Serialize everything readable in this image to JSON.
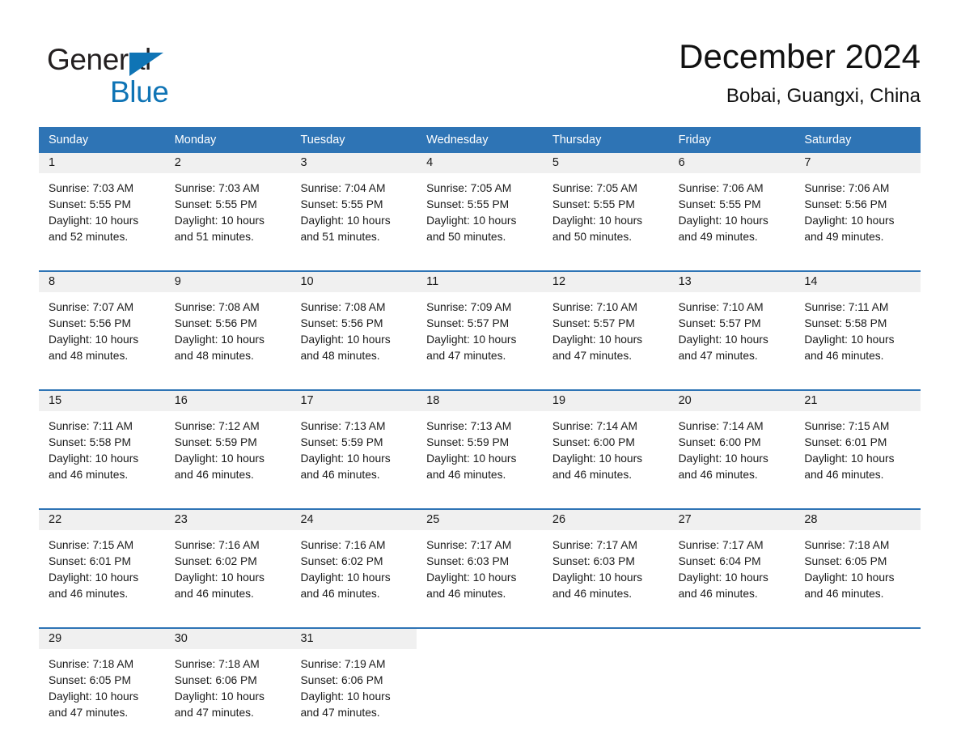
{
  "brand": {
    "name_part1": "General",
    "name_part2": "Blue",
    "triangle_color": "#0f74b5",
    "text_color": "#231f20"
  },
  "header": {
    "title": "December 2024",
    "subtitle": "Bobai, Guangxi, China"
  },
  "theme": {
    "header_blue": "#2e74b5",
    "daynum_bg": "#f0f0f0",
    "page_bg": "#ffffff"
  },
  "weekdays": [
    "Sunday",
    "Monday",
    "Tuesday",
    "Wednesday",
    "Thursday",
    "Friday",
    "Saturday"
  ],
  "weeks": [
    [
      {
        "day": "1",
        "sunrise": "Sunrise: 7:03 AM",
        "sunset": "Sunset: 5:55 PM",
        "daylight1": "Daylight: 10 hours",
        "daylight2": "and 52 minutes."
      },
      {
        "day": "2",
        "sunrise": "Sunrise: 7:03 AM",
        "sunset": "Sunset: 5:55 PM",
        "daylight1": "Daylight: 10 hours",
        "daylight2": "and 51 minutes."
      },
      {
        "day": "3",
        "sunrise": "Sunrise: 7:04 AM",
        "sunset": "Sunset: 5:55 PM",
        "daylight1": "Daylight: 10 hours",
        "daylight2": "and 51 minutes."
      },
      {
        "day": "4",
        "sunrise": "Sunrise: 7:05 AM",
        "sunset": "Sunset: 5:55 PM",
        "daylight1": "Daylight: 10 hours",
        "daylight2": "and 50 minutes."
      },
      {
        "day": "5",
        "sunrise": "Sunrise: 7:05 AM",
        "sunset": "Sunset: 5:55 PM",
        "daylight1": "Daylight: 10 hours",
        "daylight2": "and 50 minutes."
      },
      {
        "day": "6",
        "sunrise": "Sunrise: 7:06 AM",
        "sunset": "Sunset: 5:55 PM",
        "daylight1": "Daylight: 10 hours",
        "daylight2": "and 49 minutes."
      },
      {
        "day": "7",
        "sunrise": "Sunrise: 7:06 AM",
        "sunset": "Sunset: 5:56 PM",
        "daylight1": "Daylight: 10 hours",
        "daylight2": "and 49 minutes."
      }
    ],
    [
      {
        "day": "8",
        "sunrise": "Sunrise: 7:07 AM",
        "sunset": "Sunset: 5:56 PM",
        "daylight1": "Daylight: 10 hours",
        "daylight2": "and 48 minutes."
      },
      {
        "day": "9",
        "sunrise": "Sunrise: 7:08 AM",
        "sunset": "Sunset: 5:56 PM",
        "daylight1": "Daylight: 10 hours",
        "daylight2": "and 48 minutes."
      },
      {
        "day": "10",
        "sunrise": "Sunrise: 7:08 AM",
        "sunset": "Sunset: 5:56 PM",
        "daylight1": "Daylight: 10 hours",
        "daylight2": "and 48 minutes."
      },
      {
        "day": "11",
        "sunrise": "Sunrise: 7:09 AM",
        "sunset": "Sunset: 5:57 PM",
        "daylight1": "Daylight: 10 hours",
        "daylight2": "and 47 minutes."
      },
      {
        "day": "12",
        "sunrise": "Sunrise: 7:10 AM",
        "sunset": "Sunset: 5:57 PM",
        "daylight1": "Daylight: 10 hours",
        "daylight2": "and 47 minutes."
      },
      {
        "day": "13",
        "sunrise": "Sunrise: 7:10 AM",
        "sunset": "Sunset: 5:57 PM",
        "daylight1": "Daylight: 10 hours",
        "daylight2": "and 47 minutes."
      },
      {
        "day": "14",
        "sunrise": "Sunrise: 7:11 AM",
        "sunset": "Sunset: 5:58 PM",
        "daylight1": "Daylight: 10 hours",
        "daylight2": "and 46 minutes."
      }
    ],
    [
      {
        "day": "15",
        "sunrise": "Sunrise: 7:11 AM",
        "sunset": "Sunset: 5:58 PM",
        "daylight1": "Daylight: 10 hours",
        "daylight2": "and 46 minutes."
      },
      {
        "day": "16",
        "sunrise": "Sunrise: 7:12 AM",
        "sunset": "Sunset: 5:59 PM",
        "daylight1": "Daylight: 10 hours",
        "daylight2": "and 46 minutes."
      },
      {
        "day": "17",
        "sunrise": "Sunrise: 7:13 AM",
        "sunset": "Sunset: 5:59 PM",
        "daylight1": "Daylight: 10 hours",
        "daylight2": "and 46 minutes."
      },
      {
        "day": "18",
        "sunrise": "Sunrise: 7:13 AM",
        "sunset": "Sunset: 5:59 PM",
        "daylight1": "Daylight: 10 hours",
        "daylight2": "and 46 minutes."
      },
      {
        "day": "19",
        "sunrise": "Sunrise: 7:14 AM",
        "sunset": "Sunset: 6:00 PM",
        "daylight1": "Daylight: 10 hours",
        "daylight2": "and 46 minutes."
      },
      {
        "day": "20",
        "sunrise": "Sunrise: 7:14 AM",
        "sunset": "Sunset: 6:00 PM",
        "daylight1": "Daylight: 10 hours",
        "daylight2": "and 46 minutes."
      },
      {
        "day": "21",
        "sunrise": "Sunrise: 7:15 AM",
        "sunset": "Sunset: 6:01 PM",
        "daylight1": "Daylight: 10 hours",
        "daylight2": "and 46 minutes."
      }
    ],
    [
      {
        "day": "22",
        "sunrise": "Sunrise: 7:15 AM",
        "sunset": "Sunset: 6:01 PM",
        "daylight1": "Daylight: 10 hours",
        "daylight2": "and 46 minutes."
      },
      {
        "day": "23",
        "sunrise": "Sunrise: 7:16 AM",
        "sunset": "Sunset: 6:02 PM",
        "daylight1": "Daylight: 10 hours",
        "daylight2": "and 46 minutes."
      },
      {
        "day": "24",
        "sunrise": "Sunrise: 7:16 AM",
        "sunset": "Sunset: 6:02 PM",
        "daylight1": "Daylight: 10 hours",
        "daylight2": "and 46 minutes."
      },
      {
        "day": "25",
        "sunrise": "Sunrise: 7:17 AM",
        "sunset": "Sunset: 6:03 PM",
        "daylight1": "Daylight: 10 hours",
        "daylight2": "and 46 minutes."
      },
      {
        "day": "26",
        "sunrise": "Sunrise: 7:17 AM",
        "sunset": "Sunset: 6:03 PM",
        "daylight1": "Daylight: 10 hours",
        "daylight2": "and 46 minutes."
      },
      {
        "day": "27",
        "sunrise": "Sunrise: 7:17 AM",
        "sunset": "Sunset: 6:04 PM",
        "daylight1": "Daylight: 10 hours",
        "daylight2": "and 46 minutes."
      },
      {
        "day": "28",
        "sunrise": "Sunrise: 7:18 AM",
        "sunset": "Sunset: 6:05 PM",
        "daylight1": "Daylight: 10 hours",
        "daylight2": "and 46 minutes."
      }
    ],
    [
      {
        "day": "29",
        "sunrise": "Sunrise: 7:18 AM",
        "sunset": "Sunset: 6:05 PM",
        "daylight1": "Daylight: 10 hours",
        "daylight2": "and 47 minutes."
      },
      {
        "day": "30",
        "sunrise": "Sunrise: 7:18 AM",
        "sunset": "Sunset: 6:06 PM",
        "daylight1": "Daylight: 10 hours",
        "daylight2": "and 47 minutes."
      },
      {
        "day": "31",
        "sunrise": "Sunrise: 7:19 AM",
        "sunset": "Sunset: 6:06 PM",
        "daylight1": "Daylight: 10 hours",
        "daylight2": "and 47 minutes."
      },
      {
        "day": "",
        "sunrise": "",
        "sunset": "",
        "daylight1": "",
        "daylight2": ""
      },
      {
        "day": "",
        "sunrise": "",
        "sunset": "",
        "daylight1": "",
        "daylight2": ""
      },
      {
        "day": "",
        "sunrise": "",
        "sunset": "",
        "daylight1": "",
        "daylight2": ""
      },
      {
        "day": "",
        "sunrise": "",
        "sunset": "",
        "daylight1": "",
        "daylight2": ""
      }
    ]
  ]
}
